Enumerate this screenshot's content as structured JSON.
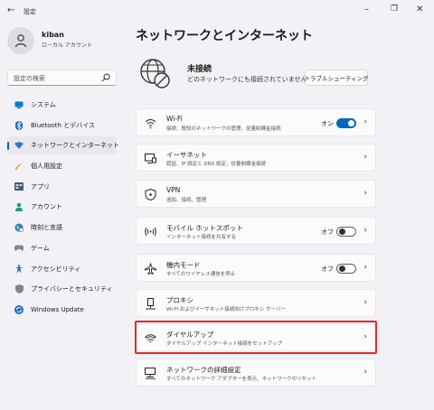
{
  "window": {
    "back_glyph": "←",
    "app_title": "設定",
    "minimize_glyph": "–",
    "maximize_glyph": "❐",
    "close_glyph": "✕"
  },
  "profile": {
    "name": "kiban",
    "account_type": "ローカル アカウント"
  },
  "search": {
    "placeholder": "設定の検索"
  },
  "sidebar": {
    "items": [
      {
        "label": "システム",
        "icon": "monitor-icon",
        "active": false
      },
      {
        "label": "Bluetooth とデバイス",
        "icon": "bluetooth-icon",
        "active": false
      },
      {
        "label": "ネットワークとインターネット",
        "icon": "network-icon",
        "active": true
      },
      {
        "label": "個人用設定",
        "icon": "brush-icon",
        "active": false
      },
      {
        "label": "アプリ",
        "icon": "apps-icon",
        "active": false
      },
      {
        "label": "アカウント",
        "icon": "person-icon",
        "active": false
      },
      {
        "label": "時刻と言語",
        "icon": "globe-clock-icon",
        "active": false
      },
      {
        "label": "ゲーム",
        "icon": "gamepad-icon",
        "active": false
      },
      {
        "label": "アクセシビリティ",
        "icon": "accessibility-icon",
        "active": false
      },
      {
        "label": "プライバシーとセキュリティ",
        "icon": "shield-icon",
        "active": false
      },
      {
        "label": "Windows Update",
        "icon": "update-icon",
        "active": false
      }
    ]
  },
  "main": {
    "title": "ネットワークとインターネット",
    "status": {
      "title": "未接続",
      "description": "どのネットワークにも接続されていません。",
      "troubleshoot_label": "トラブルシューティング"
    },
    "cards": [
      {
        "title": "Wi-Fi",
        "desc": "接続、既知のネットワークの管理、従量制課金接続",
        "icon": "wifi-icon",
        "toggle_label": "オン",
        "toggle_on": true
      },
      {
        "title": "イーサネット",
        "desc": "認証、IP 設定と DNS 設定、従量制課金接続",
        "icon": "ethernet-icon"
      },
      {
        "title": "VPN",
        "desc": "追加、接続、管理",
        "icon": "vpn-shield-icon"
      },
      {
        "title": "モバイル ホットスポット",
        "desc": "インターネット接続を共有する",
        "icon": "hotspot-icon",
        "toggle_label": "オフ",
        "toggle_on": false
      },
      {
        "title": "機内モード",
        "desc": "すべてのワイヤレス通信を停止",
        "icon": "airplane-icon",
        "toggle_label": "オフ",
        "toggle_on": false
      },
      {
        "title": "プロキシ",
        "desc": "Wi-Fi およびイーサネット接続向けプロキシ サーバー",
        "icon": "proxy-icon"
      },
      {
        "title": "ダイヤルアップ",
        "desc": "ダイヤルアップ インターネット接続をセットアップ",
        "icon": "dialup-icon"
      },
      {
        "title": "ネットワークの詳細設定",
        "desc": "すべてのネットワーク アダプターを表示、ネットワークのリセット",
        "icon": "advanced-network-icon"
      }
    ]
  },
  "colors": {
    "accent": "#0067c0",
    "highlight": "#e22a2a",
    "background": "#f3f1f6"
  }
}
